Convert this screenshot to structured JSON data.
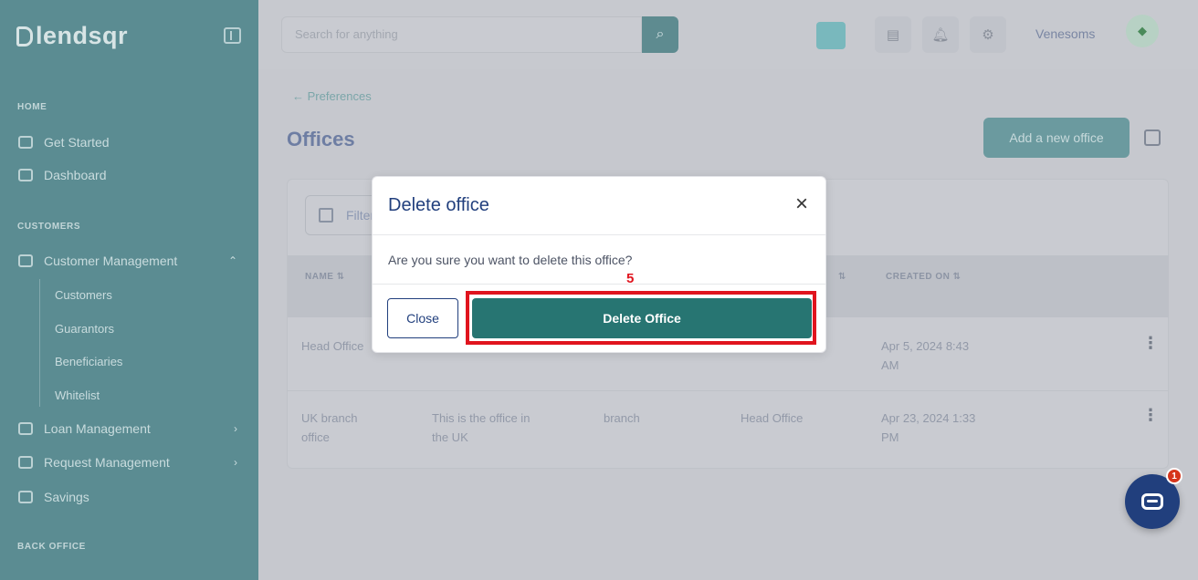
{
  "sidebar": {
    "logo": "lendsqr",
    "sections": {
      "home": "HOME",
      "customers": "CUSTOMERS",
      "back_office": "BACK OFFICE"
    },
    "items": {
      "get_started": "Get Started",
      "dashboard": "Dashboard",
      "customer_management": "Customer Management",
      "loan_management": "Loan Management",
      "request_management": "Request Management",
      "savings": "Savings"
    },
    "sub_items": [
      "Customers",
      "Guarantors",
      "Beneficiaries",
      "Whitelist"
    ]
  },
  "header": {
    "search_placeholder": "Search for anything",
    "user_name": "Venesoms"
  },
  "page": {
    "breadcrumb": "Preferences",
    "title": "Offices",
    "add_button": "Add a new office",
    "filter_label": "Filter",
    "columns": {
      "name": "NAME",
      "created_on": "CREATED ON"
    },
    "rows": [
      {
        "name": "Head Office",
        "description": "",
        "type": "",
        "parent": "",
        "created_line1": "Apr 5, 2024 8:43",
        "created_line2": "AM"
      },
      {
        "name_line1": "UK branch",
        "name_line2": "office",
        "desc_line1": "This is the office in",
        "desc_line2": "the UK",
        "type": "branch",
        "parent": "Head Office",
        "created_line1": "Apr 23, 2024 1:33",
        "created_line2": "PM"
      }
    ]
  },
  "modal": {
    "title": "Delete office",
    "close_symbol": "×",
    "body": "Are you sure you want to delete this office?",
    "close_button": "Close",
    "delete_button": "Delete Office"
  },
  "annotation": {
    "step_number": "5",
    "color": "#e0141e"
  },
  "chat": {
    "badge_count": "1"
  },
  "colors": {
    "brand_teal": "#277572",
    "navy": "#213f7d",
    "sidebar": "#5b8c92"
  }
}
